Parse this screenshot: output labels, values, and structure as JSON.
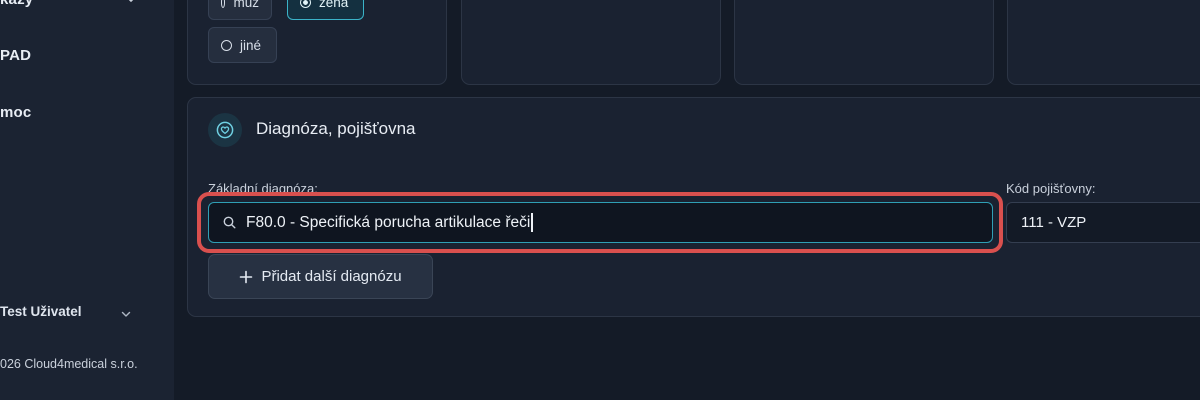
{
  "sidebar": {
    "items": [
      {
        "label": "kazy"
      },
      {
        "label": "PAD"
      },
      {
        "label": "moc"
      }
    ],
    "user": {
      "name": "Test Uživatel"
    },
    "copyright": "026 Cloud4medical s.r.o."
  },
  "gender": {
    "options": [
      {
        "label": "muž",
        "selected": false
      },
      {
        "label": "žena",
        "selected": true
      },
      {
        "label": "jiné",
        "selected": false
      }
    ]
  },
  "diagnoza_section": {
    "title": "Diagnóza, pojišťovna",
    "zakladni_label": "Základní diagnóza:",
    "zakladni_value": "F80.0 - Specifická porucha artikulace řeči",
    "kod_label": "Kód pojišťovny:",
    "kod_value": "111 - VZP",
    "add_button_label": "Přidat další diagnózu"
  },
  "colors": {
    "accent": "#3bb3c8",
    "highlight": "#d9504e",
    "background": "#141b27"
  },
  "icons": [
    "chevron-down-icon",
    "heart-circle-icon",
    "search-icon",
    "plus-icon"
  ]
}
